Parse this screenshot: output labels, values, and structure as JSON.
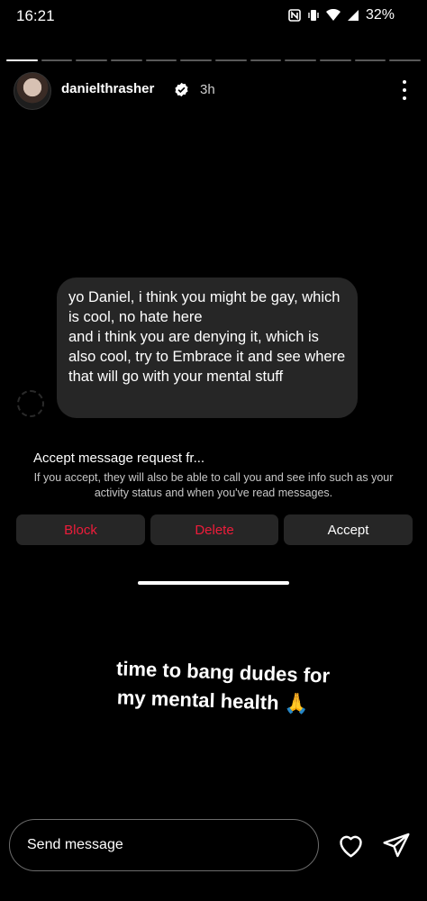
{
  "status_bar": {
    "time": "16:21",
    "battery": "32%",
    "icons": [
      "nfc-icon",
      "vibrate-icon",
      "wifi-icon",
      "signal-icon"
    ]
  },
  "story": {
    "segments_total": 12,
    "active_segment": 1,
    "username": "danielthrasher",
    "time_ago": "3h",
    "caption_line1": "time to bang dudes for",
    "caption_line2": "my mental health 🙏"
  },
  "message": {
    "paragraph1": "yo Daniel, i think you might be gay, which is cool, no hate here",
    "paragraph2": "and i think you are denying it, which is also cool, try to Embrace it and see where that will go with your mental stuff"
  },
  "request": {
    "title": "Accept message request fr...",
    "description": "If you accept, they will also be able to call you and see info such as your activity status and when you've read messages.",
    "block_label": "Block",
    "delete_label": "Delete",
    "accept_label": "Accept"
  },
  "footer": {
    "placeholder": "Send message"
  },
  "colors": {
    "danger": "#ed1c3a",
    "surface": "#262626"
  }
}
